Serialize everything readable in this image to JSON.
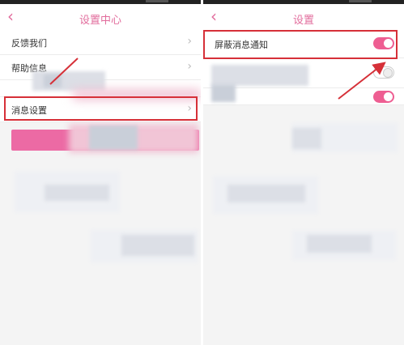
{
  "left_screen": {
    "title": "设置中心",
    "back_icon": "chevron-left-icon",
    "items": [
      {
        "label": "反馈我们",
        "icon": "chevron-right-icon"
      },
      {
        "label": "帮助信息",
        "icon": "chevron-right-icon"
      },
      {
        "label": "消息设置",
        "icon": "chevron-right-icon"
      }
    ]
  },
  "right_screen": {
    "title": "设置",
    "back_icon": "chevron-left-icon",
    "items": [
      {
        "label": "屏蔽消息通知",
        "toggle": "on"
      }
    ]
  },
  "colors": {
    "accent": "#e26d9d",
    "highlight": "#d63038",
    "toggle_on": "#ee5e92"
  }
}
